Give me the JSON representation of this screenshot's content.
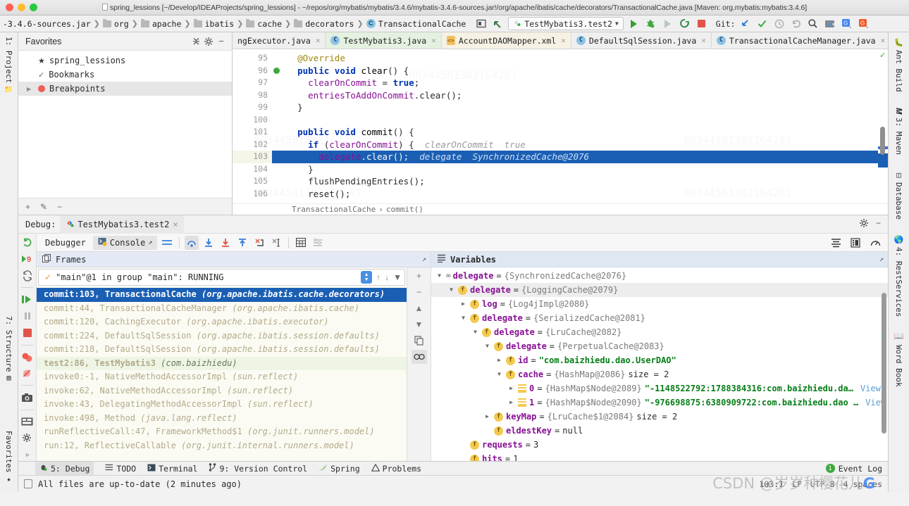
{
  "titlebar": {
    "title": "spring_lessions [~/Develop/IDEAProjects/spring_lessions] - ~/repos/org/mybatis/mybatis/3.4.6/mybatis-3.4.6-sources.jar!/org/apache/ibatis/cache/decorators/TransactionalCache.java [Maven: org.mybatis:mybatis:3.4.6]"
  },
  "navbar": {
    "breadcrumbs": [
      {
        "label": "-3.4.6-sources.jar",
        "icon": "jar-icon"
      },
      {
        "label": "org",
        "icon": "folder-icon"
      },
      {
        "label": "apache",
        "icon": "folder-icon"
      },
      {
        "label": "ibatis",
        "icon": "folder-icon"
      },
      {
        "label": "cache",
        "icon": "folder-icon"
      },
      {
        "label": "decorators",
        "icon": "folder-icon"
      },
      {
        "label": "TransactionalCache",
        "icon": "class-icon"
      }
    ],
    "run_configuration": "TestMybatis3.test2",
    "git_label": "Git:"
  },
  "favorites": {
    "title": "Favorites",
    "items": [
      {
        "label": "spring_lessions",
        "icon": "star-icon",
        "selected": false
      },
      {
        "label": "Bookmarks",
        "icon": "check-icon",
        "selected": false
      },
      {
        "label": "Breakpoints",
        "icon": "breakpoint-icon",
        "selected": true
      }
    ]
  },
  "editor_tabs": [
    {
      "label": "ngExecutor.java",
      "style": "plain",
      "icon": ""
    },
    {
      "label": "TestMybatis3.java",
      "style": "green",
      "icon": "class-icon"
    },
    {
      "label": "AccountDAOMapper.xml",
      "style": "cream",
      "icon": "xml-icon"
    },
    {
      "label": "DefaultSqlSession.java",
      "style": "plain",
      "icon": "class-icon"
    },
    {
      "label": "TransactionalCacheManager.java",
      "style": "plain",
      "icon": "class-icon"
    }
  ],
  "editor": {
    "lines": [
      {
        "n": "95",
        "html": "    <span class='ann'>@Override</span>",
        "current": false,
        "breakpoint": false
      },
      {
        "n": "96",
        "html": "    <span class='kw'>public void</span> <span class='pn'>clear</span>() {",
        "current": false,
        "breakpoint": true
      },
      {
        "n": "97",
        "html": "      <span class='fld'>clearOnCommit</span> = <span class='kw'>true</span>;",
        "current": false,
        "breakpoint": false
      },
      {
        "n": "98",
        "html": "      <span class='fld'>entriesToAddOnCommit</span>.clear();",
        "current": false,
        "breakpoint": false
      },
      {
        "n": "99",
        "html": "    }",
        "current": false,
        "breakpoint": false
      },
      {
        "n": "100",
        "html": "",
        "current": false,
        "breakpoint": false
      },
      {
        "n": "101",
        "html": "    <span class='kw'>public void</span> <span class='pn'>commit</span>() {",
        "current": false,
        "breakpoint": false
      },
      {
        "n": "102",
        "html": "      <span class='kw'>if</span> (<span class='fld'>clearOnCommit</span>) {  <span class='hint'>clearOnCommit  true</span>",
        "current": false,
        "breakpoint": false
      },
      {
        "n": "103",
        "html": "        <span class='fld'>delegate</span>.clear();  <span class='hint'>delegate  SynchronizedCache@2076</span>",
        "current": true,
        "breakpoint": false
      },
      {
        "n": "104",
        "html": "      }",
        "current": false,
        "breakpoint": false
      },
      {
        "n": "105",
        "html": "      flushPendingEntries();",
        "current": false,
        "breakpoint": false
      },
      {
        "n": "106",
        "html": "      reset();",
        "current": false,
        "breakpoint": false
      }
    ],
    "breadcrumb_class": "TransactionalCache",
    "breadcrumb_method": "commit()"
  },
  "debug": {
    "label": "Debug:",
    "session_tab": "TestMybatis3.test2",
    "tab_debugger": "Debugger",
    "tab_console": "Console",
    "frames_title": "Frames",
    "variables_title": "Variables",
    "thread": "\"main\"@1 in group \"main\": RUNNING",
    "frames": [
      {
        "method": "commit:103, TransactionalCache",
        "pkg": "(org.apache.ibatis.cache.decorators)",
        "state": "selected"
      },
      {
        "method": "commit:44, TransactionalCacheManager",
        "pkg": "(org.apache.ibatis.cache)",
        "state": "lib"
      },
      {
        "method": "commit:120, CachingExecutor",
        "pkg": "(org.apache.ibatis.executor)",
        "state": "lib"
      },
      {
        "method": "commit:224, DefaultSqlSession",
        "pkg": "(org.apache.ibatis.session.defaults)",
        "state": "lib"
      },
      {
        "method": "commit:218, DefaultSqlSession",
        "pkg": "(org.apache.ibatis.session.defaults)",
        "state": "lib"
      },
      {
        "method": "test2:86, TestMybatis3",
        "pkg": "(com.baizhiedu)",
        "state": "user"
      },
      {
        "method": "invoke0:-1, NativeMethodAccessorImpl",
        "pkg": "(sun.reflect)",
        "state": "lib"
      },
      {
        "method": "invoke:62, NativeMethodAccessorImpl",
        "pkg": "(sun.reflect)",
        "state": "lib"
      },
      {
        "method": "invoke:43, DelegatingMethodAccessorImpl",
        "pkg": "(sun.reflect)",
        "state": "lib"
      },
      {
        "method": "invoke:498, Method",
        "pkg": "(java.lang.reflect)",
        "state": "lib"
      },
      {
        "method": "runReflectiveCall:47, FrameworkMethod$1",
        "pkg": "(org.junit.runners.model)",
        "state": "lib"
      },
      {
        "method": "run:12, ReflectiveCallable",
        "pkg": "(org.junit.internal.runners.model)",
        "state": "lib"
      }
    ],
    "variables": [
      {
        "indent": 0,
        "twisty": "▼",
        "badge": "oo",
        "name": "delegate",
        "eq": "=",
        "value": "{SynchronizedCache@2076}",
        "extra": "",
        "highlight": false
      },
      {
        "indent": 1,
        "twisty": "▼",
        "badge": "f",
        "name": "delegate",
        "eq": "=",
        "value": "{LoggingCache@2079}",
        "extra": "",
        "highlight": true
      },
      {
        "indent": 2,
        "twisty": "▶",
        "badge": "f",
        "name": "log",
        "eq": "=",
        "value": "{Log4jImpl@2080}",
        "extra": "",
        "highlight": false
      },
      {
        "indent": 2,
        "twisty": "▼",
        "badge": "f",
        "name": "delegate",
        "eq": "=",
        "value": "{SerializedCache@2081}",
        "extra": "",
        "highlight": false
      },
      {
        "indent": 3,
        "twisty": "▼",
        "badge": "f",
        "name": "delegate",
        "eq": "=",
        "value": "{LruCache@2082}",
        "extra": "",
        "highlight": false
      },
      {
        "indent": 4,
        "twisty": "▼",
        "badge": "f",
        "name": "delegate",
        "eq": "=",
        "value": "{PerpetualCache@2083}",
        "extra": "",
        "highlight": false
      },
      {
        "indent": 5,
        "twisty": "▶",
        "badge": "f",
        "name": "id",
        "eq": "=",
        "value": "",
        "string": "\"com.baizhiedu.dao.UserDAO\"",
        "extra": "",
        "highlight": false
      },
      {
        "indent": 5,
        "twisty": "▼",
        "badge": "f",
        "name": "cache",
        "eq": "=",
        "value": "{HashMap@2086}",
        "extra": "size = 2",
        "highlight": false
      },
      {
        "indent": 6,
        "twisty": "▶",
        "badge": "list",
        "name": "0",
        "eq": "=",
        "value": "{HashMap$Node@2089}",
        "string": "\"-1148522792:1788384316:com.baizhiedu.da…",
        "link": "View",
        "extra": "",
        "highlight": false
      },
      {
        "indent": 6,
        "twisty": "▶",
        "badge": "list",
        "name": "1",
        "eq": "=",
        "value": "{HashMap$Node@2090}",
        "string": "\"-976698875:6380909722:com.baizhiedu.dao …",
        "link": "View",
        "extra": "",
        "highlight": false
      },
      {
        "indent": 4,
        "twisty": "▶",
        "badge": "f",
        "name": "keyMap",
        "eq": "=",
        "value": "{LruCache$1@2084}",
        "extra": "size = 2",
        "highlight": false
      },
      {
        "indent": 4,
        "twisty": "",
        "badge": "f",
        "name": "eldestKey",
        "eq": "=",
        "value": "",
        "plain": "null",
        "extra": "",
        "highlight": false
      },
      {
        "indent": 2,
        "twisty": "",
        "badge": "f",
        "name": "requests",
        "eq": "=",
        "value": "",
        "plain": "3",
        "extra": "",
        "highlight": false
      },
      {
        "indent": 2,
        "twisty": "",
        "badge": "f",
        "name": "hits",
        "eq": "=",
        "value": "",
        "plain": "1",
        "extra": "",
        "highlight": false
      }
    ]
  },
  "left_strip": [
    {
      "label": "1: Project",
      "icon": "project-icon"
    },
    {
      "label": "7: Structure",
      "icon": "structure-icon"
    },
    {
      "label": "Favorites",
      "icon": "star-icon"
    }
  ],
  "right_strip": [
    {
      "label": "Ant Build",
      "icon": "ant-icon"
    },
    {
      "label": "3: Maven",
      "icon": "maven-icon"
    },
    {
      "label": "Database",
      "icon": "database-icon"
    },
    {
      "label": "4: RestServices",
      "icon": "rest-icon"
    },
    {
      "label": "Word Book",
      "icon": "book-icon"
    }
  ],
  "bottom_tools": [
    {
      "label": "5: Debug",
      "icon": "bug-icon",
      "active": true
    },
    {
      "label": "TODO",
      "icon": "todo-icon",
      "active": false
    },
    {
      "label": "Terminal",
      "icon": "terminal-icon",
      "active": false
    },
    {
      "label": "9: Version Control",
      "icon": "vcs-icon",
      "active": false
    },
    {
      "label": "Spring",
      "icon": "spring-icon",
      "active": false
    },
    {
      "label": "Problems",
      "icon": "warning-icon",
      "active": false
    }
  ],
  "event_log": {
    "count": "1",
    "label": "Event Log"
  },
  "statusbar": {
    "message": "All files are up-to-date (2 minutes ago)",
    "caret": "103:1",
    "line_sep": "LF",
    "encoding": "UTF-8",
    "indent": "4 spaces",
    "watermark": "CSDN @岁岁种樱花儿"
  }
}
